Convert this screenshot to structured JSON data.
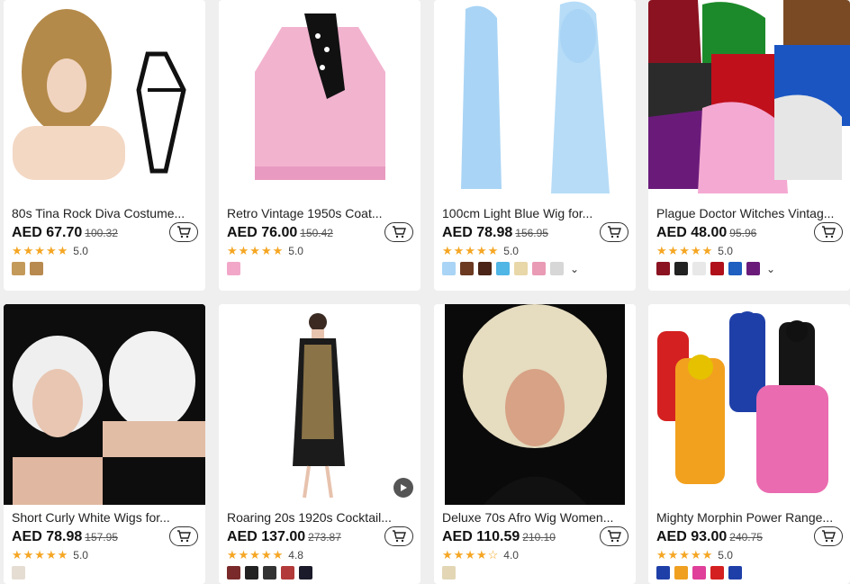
{
  "products": [
    {
      "title": "80s Tina Rock Diva Costume...",
      "price": "AED 67.70",
      "orig": "100.32",
      "stars": "★★★★★",
      "rating": "5.0",
      "swatches": [
        "#c49a5a",
        "#b88a4f"
      ],
      "more": false
    },
    {
      "title": "Retro Vintage 1950s Coat...",
      "price": "AED 76.00",
      "orig": "150.42",
      "stars": "★★★★★",
      "rating": "5.0",
      "swatches": [
        "#f2a7c9"
      ],
      "more": false
    },
    {
      "title": "100cm Light Blue Wig for...",
      "price": "AED 78.98",
      "orig": "156.95",
      "stars": "★★★★★",
      "rating": "5.0",
      "swatches": [
        "#a9d4f5",
        "#6b3a21",
        "#4a2416",
        "#4fb6e6",
        "#e8d7a8",
        "#e99ab5",
        "#d7d7d7"
      ],
      "more": true
    },
    {
      "title": "Plague Doctor Witches Vintag...",
      "price": "AED 48.00",
      "orig": "95.96",
      "stars": "★★★★★",
      "rating": "5.0",
      "swatches": [
        "#8b1220",
        "#222222",
        "#e8e8e8",
        "#b0101a",
        "#1e5fc0",
        "#6a1b7a"
      ],
      "more": true
    },
    {
      "title": "Short Curly White Wigs for...",
      "price": "AED 78.98",
      "orig": "157.95",
      "stars": "★★★★★",
      "rating": "5.0",
      "swatches": [
        "#e5ddd2"
      ],
      "more": false
    },
    {
      "title": "Roaring 20s 1920s Cocktail...",
      "price": "AED 137.00",
      "orig": "273.87",
      "stars": "★★★★★",
      "rating": "4.8",
      "swatches": [
        "#7a2a2a",
        "#222222",
        "#333333",
        "#b33a3a",
        "#1a1a2a"
      ],
      "more": false
    },
    {
      "title": "Deluxe 70s Afro Wig Women...",
      "price": "AED 110.59",
      "orig": "210.10",
      "stars": "★★★★☆",
      "rating": "4.0",
      "swatches": [
        "#e2d6b5"
      ],
      "more": false
    },
    {
      "title": "Mighty Morphin Power Range...",
      "price": "AED 93.00",
      "orig": "240.75",
      "stars": "★★★★★",
      "rating": "5.0",
      "swatches": [
        "#1f3fa8",
        "#f0a020",
        "#e0409a",
        "#d42020",
        "#1f3fa8"
      ],
      "more": false
    }
  ]
}
